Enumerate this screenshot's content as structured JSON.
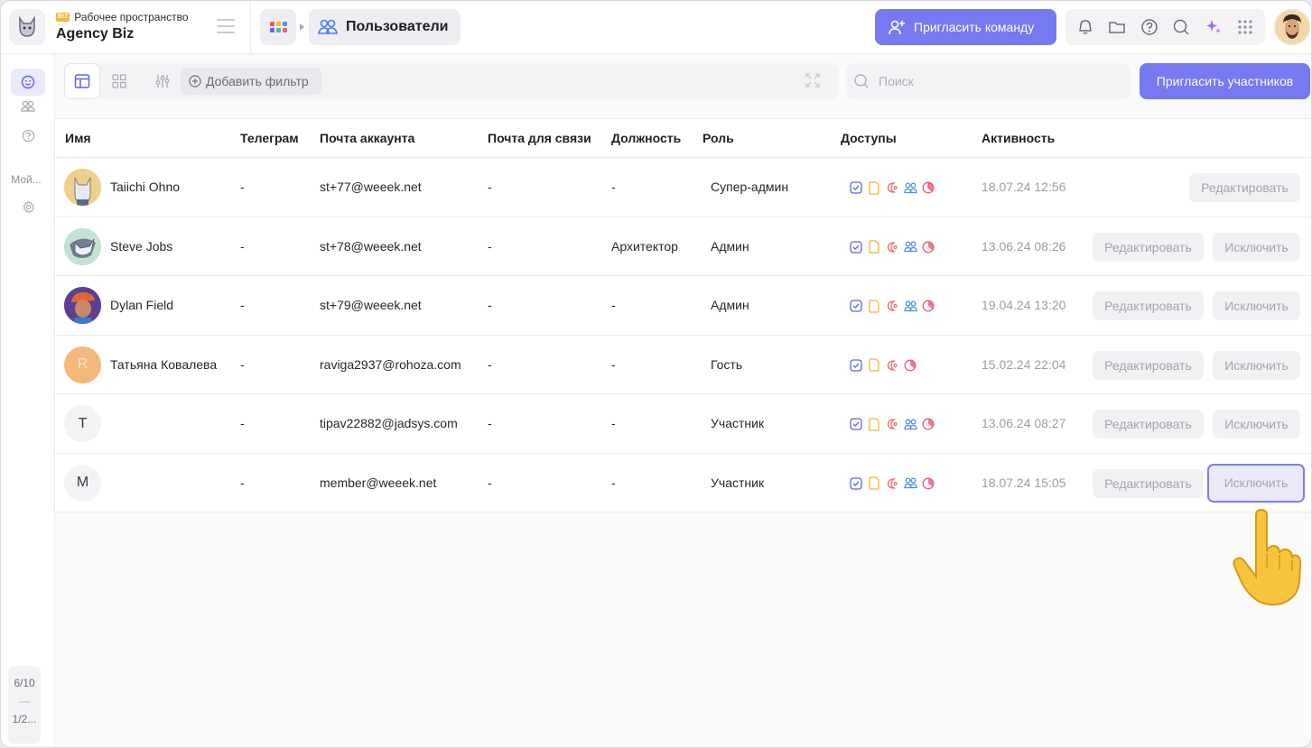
{
  "workspace": {
    "badge": "BIZ",
    "label": "Рабочее пространство",
    "name": "Agency Biz"
  },
  "breadcrumb": {
    "label": "Пользователи"
  },
  "header": {
    "invite_team_label": "Пригласить команду"
  },
  "sidebar": {
    "item_my": "Мой...",
    "counter_top": "6/10",
    "counter_sep": "—",
    "counter_bottom": "1/2..."
  },
  "toolbar": {
    "add_filter_label": "Добавить фильтр",
    "search_placeholder": "Поиск",
    "invite_members_label": "Пригласить участников"
  },
  "table": {
    "columns": [
      "Имя",
      "Телеграм",
      "Почта аккаунта",
      "Почта для связи",
      "Должность",
      "Роль",
      "Доступы",
      "Активность"
    ],
    "edit_label": "Редактировать",
    "exclude_label": "Исключить",
    "rows": [
      {
        "initial": "",
        "name": "Taiichi Ohno",
        "telegram": "-",
        "email": "st+77@weeek.net",
        "contact_email": "-",
        "position": "-",
        "role": "Супер-админ",
        "activity": "18.07.24 12:56"
      },
      {
        "initial": "",
        "name": "Steve Jobs",
        "telegram": "-",
        "email": "st+78@weeek.net",
        "contact_email": "-",
        "position": "Архитектор",
        "role": "Админ",
        "activity": "13.06.24 08:26"
      },
      {
        "initial": "",
        "name": "Dylan Field",
        "telegram": "-",
        "email": "st+79@weeek.net",
        "contact_email": "-",
        "position": "-",
        "role": "Админ",
        "activity": "19.04.24 13:20"
      },
      {
        "initial": "R",
        "name": "Татьяна Ковалева",
        "telegram": "-",
        "email": "raviga2937@rohoza.com",
        "contact_email": "-",
        "position": "-",
        "role": "Гость",
        "activity": "15.02.24 22:04"
      },
      {
        "initial": "T",
        "name": "",
        "telegram": "-",
        "email": "tipav22882@jadsys.com",
        "contact_email": "-",
        "position": "-",
        "role": "Участник",
        "activity": "13.06.24 08:27"
      },
      {
        "initial": "M",
        "name": "",
        "telegram": "-",
        "email": "member@weeek.net",
        "contact_email": "-",
        "position": "-",
        "role": "Участник",
        "activity": "18.07.24 15:05"
      }
    ]
  },
  "colors": {
    "accent": "#7679ef",
    "perm_tasks": "#5b63e8",
    "perm_docs": "#f0b43c",
    "perm_crm": "#ef6a6a",
    "perm_people": "#4f8de8",
    "perm_time": "#e85a7a"
  }
}
